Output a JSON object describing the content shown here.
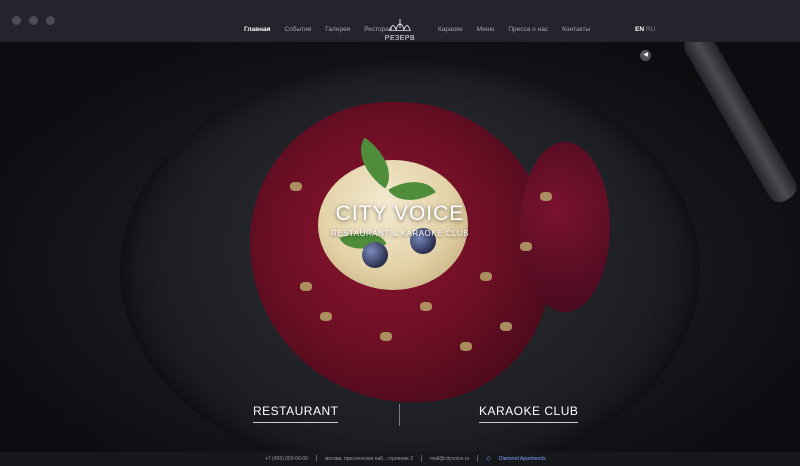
{
  "nav": {
    "left": [
      {
        "label": "Главная",
        "active": true
      },
      {
        "label": "События"
      },
      {
        "label": "Галерея"
      },
      {
        "label": "Ресторан"
      }
    ],
    "right": [
      {
        "label": "Караоке"
      },
      {
        "label": "Меню"
      },
      {
        "label": "Пресса о нас"
      },
      {
        "label": "Контакты"
      }
    ]
  },
  "logo": {
    "text": "РЕЗЕРВ"
  },
  "lang": {
    "en": "EN",
    "ru": "RU"
  },
  "hero": {
    "title": "CITY VOICE",
    "subtitle": "RESTAURANT & KARAOKE CLUB",
    "link_left": "RESTAURANT",
    "link_right": "KARAOKE CLUB",
    "audio_icon": "speaker-icon"
  },
  "footer": {
    "phone": "+7 (495) 000-00-00",
    "address": "москва, пресненская наб., строение 2",
    "email": "mail@cityvoice.ru",
    "partner": "Diamond Apartments"
  },
  "colors": {
    "titlebar": "#23242c",
    "background": "#0f1013",
    "sauce": "#6e0f25",
    "accent": "#7fa2ff"
  }
}
